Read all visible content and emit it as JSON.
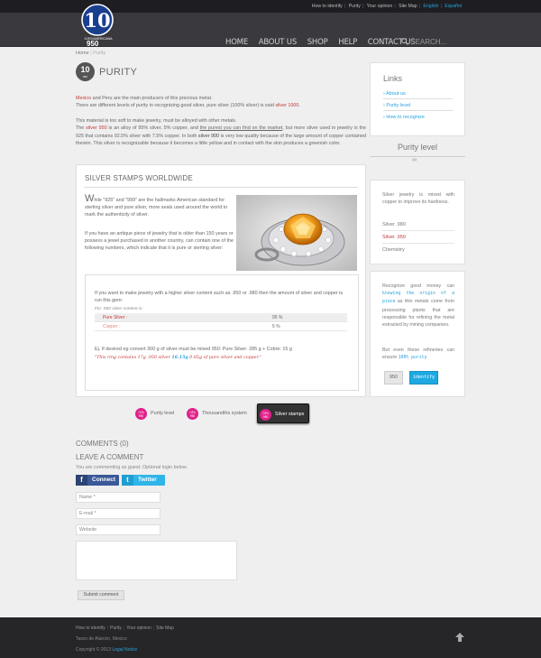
{
  "top_links": [
    "How to identify",
    "Purity",
    "Your opinion",
    "Site Map",
    "English",
    "Español"
  ],
  "logo": {
    "number": "10",
    "line1": "OJEDAMERICANA",
    "line2": "950"
  },
  "nav": [
    "HOME",
    "ABOUT US",
    "SHOP",
    "HELP",
    "CONTACT US"
  ],
  "search": {
    "placeholder": "SEARCH..."
  },
  "breadcrumb": {
    "home": "Home",
    "current": "Purity"
  },
  "page": {
    "badge_num": "10",
    "badge_sub": "950",
    "title": "PURITY"
  },
  "intro": {
    "p1_a": "Mexico",
    "p1_b": " and Peru are the main producers of this precious metal.",
    "p1_c": "There are different levels of purity in recognizing good silver, pure silver (100% silver) is said ",
    "p1_d": "silver 1000",
    "p1_e": ".",
    "p2_a": "This material is too soft to make jewelry, must be alloyed with other metals.",
    "p2_b": "The ",
    "p2_c": "silver 950",
    "p2_d": " is an alloy of 95% silver, 5% copper, and ",
    "p2_e": "the purest you can find on the market",
    "p2_f": ", but more silver used in jewelry is the 925 that contains 92.5% silver with 7.5% copper. In both ",
    "p2_g": "silver 900",
    "p2_h": " is very low quality because of the large amount of copper contained therein. This silver is recognizable because it becomes a little yellow and in contact with the skin produces a greenish color."
  },
  "stamps": {
    "title": "SILVER STAMPS WORLDWIDE",
    "dropcap": "W",
    "p1": "hile \"925\" and \"999\" are the hallmarks American standard for sterling silver and pure silver, more seals used around the world to mark the authenticity of silver.",
    "p2": "If you have an antique piece of jewelry that is older than 150 years or possess a jewel purchased in another country, can contain one of the following numbers, which indicate that it is pure or sterling silver:",
    "inner_p": "If you want to make jewelry with a higher silver content such as .950 or .980 then the amount of silver and copper is run this gem:",
    "table_caption": "For .950 silver content is:",
    "rows": [
      {
        "label": "Pure Silver :",
        "value": "95 %"
      },
      {
        "label": "Copper :",
        "value": "5 %"
      }
    ],
    "example": "Ej. If desired eg convert 300 g of silver must be mixed 950: Pure Silver: 285 g + Cobre: 15 g",
    "note_a": "\"This ring contains 17g .950 silver ",
    "note_b": "16.15g",
    "note_c": " 0.85g of pure silver and copper.\""
  },
  "tabs": [
    {
      "icon_top": "OFA",
      "icon_bottom": "950",
      "label": "Purity level"
    },
    {
      "icon_top": "OFA",
      "icon_bottom": "950",
      "label": "Thousandths system"
    },
    {
      "icon_top": "OFA",
      "icon_bottom": "950",
      "label": "Silver stamps"
    }
  ],
  "comments": {
    "count_title": "COMMENTS (0)",
    "leave_title": "LEAVE A COMMENT",
    "guest_note": "You are commenting as guest. Optional login below.",
    "facebook": "Connect",
    "twitter": "Twitter",
    "name_ph": "Name *",
    "email_ph": "E-mail *",
    "website_ph": "Website",
    "submit": "Submit comment"
  },
  "sidebar": {
    "links_title": "Links",
    "links": [
      "› About us",
      "› Purity level",
      "› How to recognize"
    ],
    "purity_title": "Purity level",
    "purity_text": "Silver jewelry is mixed with copper to improve its hardness.",
    "levels": [
      "Silver .980",
      "Silver .950",
      "Chemistry"
    ],
    "identify_a": "Recognize good money can ",
    "identify_b": "knowing the origin of a piece",
    "identify_c": " as thin metals come from processing plants that are responsible for refining the metal extracted by mining companies.",
    "identify_d": "But even these refineries can ensure ",
    "identify_e": "100% purity",
    "btn_950": "950",
    "btn_identify": "identify"
  },
  "footer": {
    "links": [
      "How to identify",
      "Purity",
      "Your opinion",
      "Site Map"
    ],
    "address": "Taxco de Alarcón, Mexico",
    "copyright": "Copyright © 2013 ",
    "legal": "Legal Notice"
  },
  "colors": {
    "accent_blue": "#27a3dd",
    "accent_red": "#c23a3a",
    "badge_pink": "#e0208a",
    "header_bg": "#3a3a3e"
  }
}
